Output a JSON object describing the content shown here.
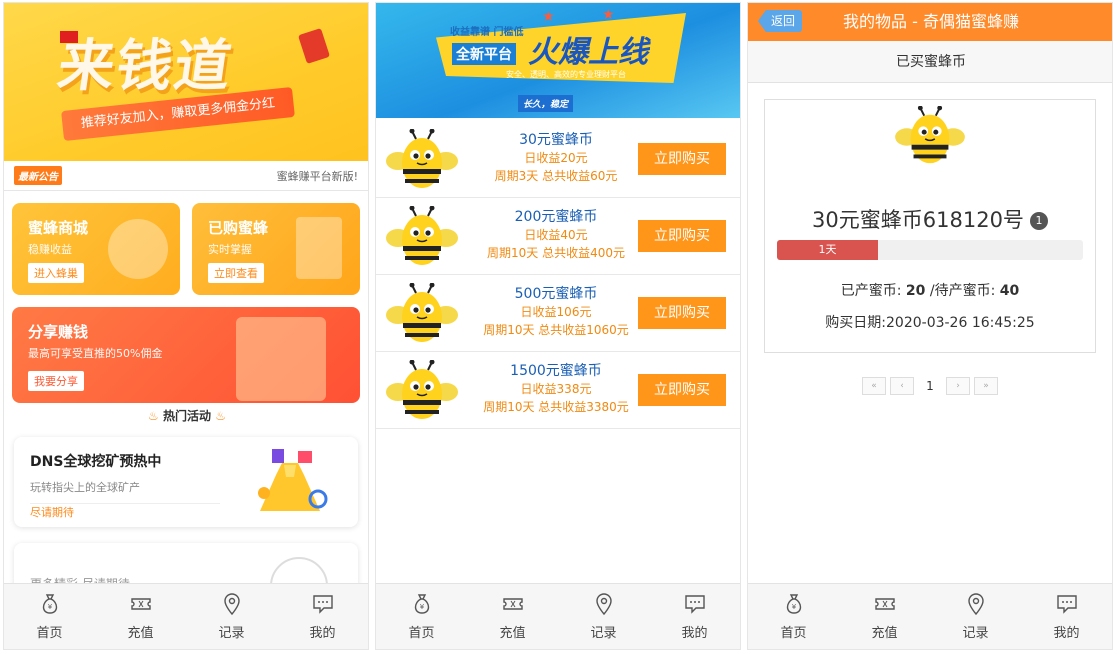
{
  "phone1": {
    "hero_title": "来钱道",
    "hero_slogan": "推荐好友加入，赚取更多佣金分红",
    "notice_tag": "最新公告",
    "notice_text": "蜜蜂赚平台新版!",
    "card_shop": {
      "title": "蜜蜂商城",
      "sub": "稳赚收益",
      "button": "进入蜂巢"
    },
    "card_bought": {
      "title": "已购蜜蜂",
      "sub": "实时掌握",
      "button": "立即查看"
    },
    "card_share": {
      "title": "分享赚钱",
      "sub": "最高可享受直推的50%佣金",
      "button": "我要分享"
    },
    "hot_label": "热门活动",
    "activity1": {
      "title": "DNS全球挖矿预热中",
      "desc": "玩转指尖上的全球矿产",
      "link": "尽请期待"
    },
    "activity2": {
      "desc": "更多精彩 尽请期待"
    }
  },
  "phone2": {
    "hero_pre": "收益靠谱 门槛低",
    "hero_new": "全新平台",
    "hero_big": "火爆上线",
    "hero_small": "安全、透明、高效的专业理财平台",
    "hero_tag": "长久，稳定",
    "buy_label": "立即购买",
    "products": [
      {
        "name": "30元蜜蜂币",
        "income": "日收益20元",
        "period": "周期3天 总共收益60元"
      },
      {
        "name": "200元蜜蜂币",
        "income": "日收益40元",
        "period": "周期10天 总共收益400元"
      },
      {
        "name": "500元蜜蜂币",
        "income": "日收益106元",
        "period": "周期10天 总共收益1060元"
      },
      {
        "name": "1500元蜜蜂币",
        "income": "日收益338元",
        "period": "周期10天 总共收益3380元"
      }
    ]
  },
  "phone3": {
    "back": "返回",
    "title": "我的物品 - 奇偶猫蜜蜂赚",
    "subtitle": "已买蜜蜂币",
    "item_name": "30元蜜蜂币618120号",
    "item_badge": "1",
    "progress_label": "1天",
    "progress_fraction": 0.33,
    "produced_label": "已产蜜币:",
    "produced_value": "20",
    "pending_label": "/待产蜜币:",
    "pending_value": "40",
    "purchase_date": "购买日期:2020-03-26 16:45:25",
    "pager": {
      "first": "«",
      "prev": "‹",
      "current": "1",
      "next": "›",
      "last": "»"
    }
  },
  "tabbar": {
    "home": "首页",
    "recharge": "充值",
    "records": "记录",
    "mine": "我的"
  },
  "colors": {
    "accent_orange": "#ff8a2a",
    "buy_orange": "#ff961a",
    "product_blue": "#1a5fb4",
    "progress_red": "#d9534f"
  }
}
